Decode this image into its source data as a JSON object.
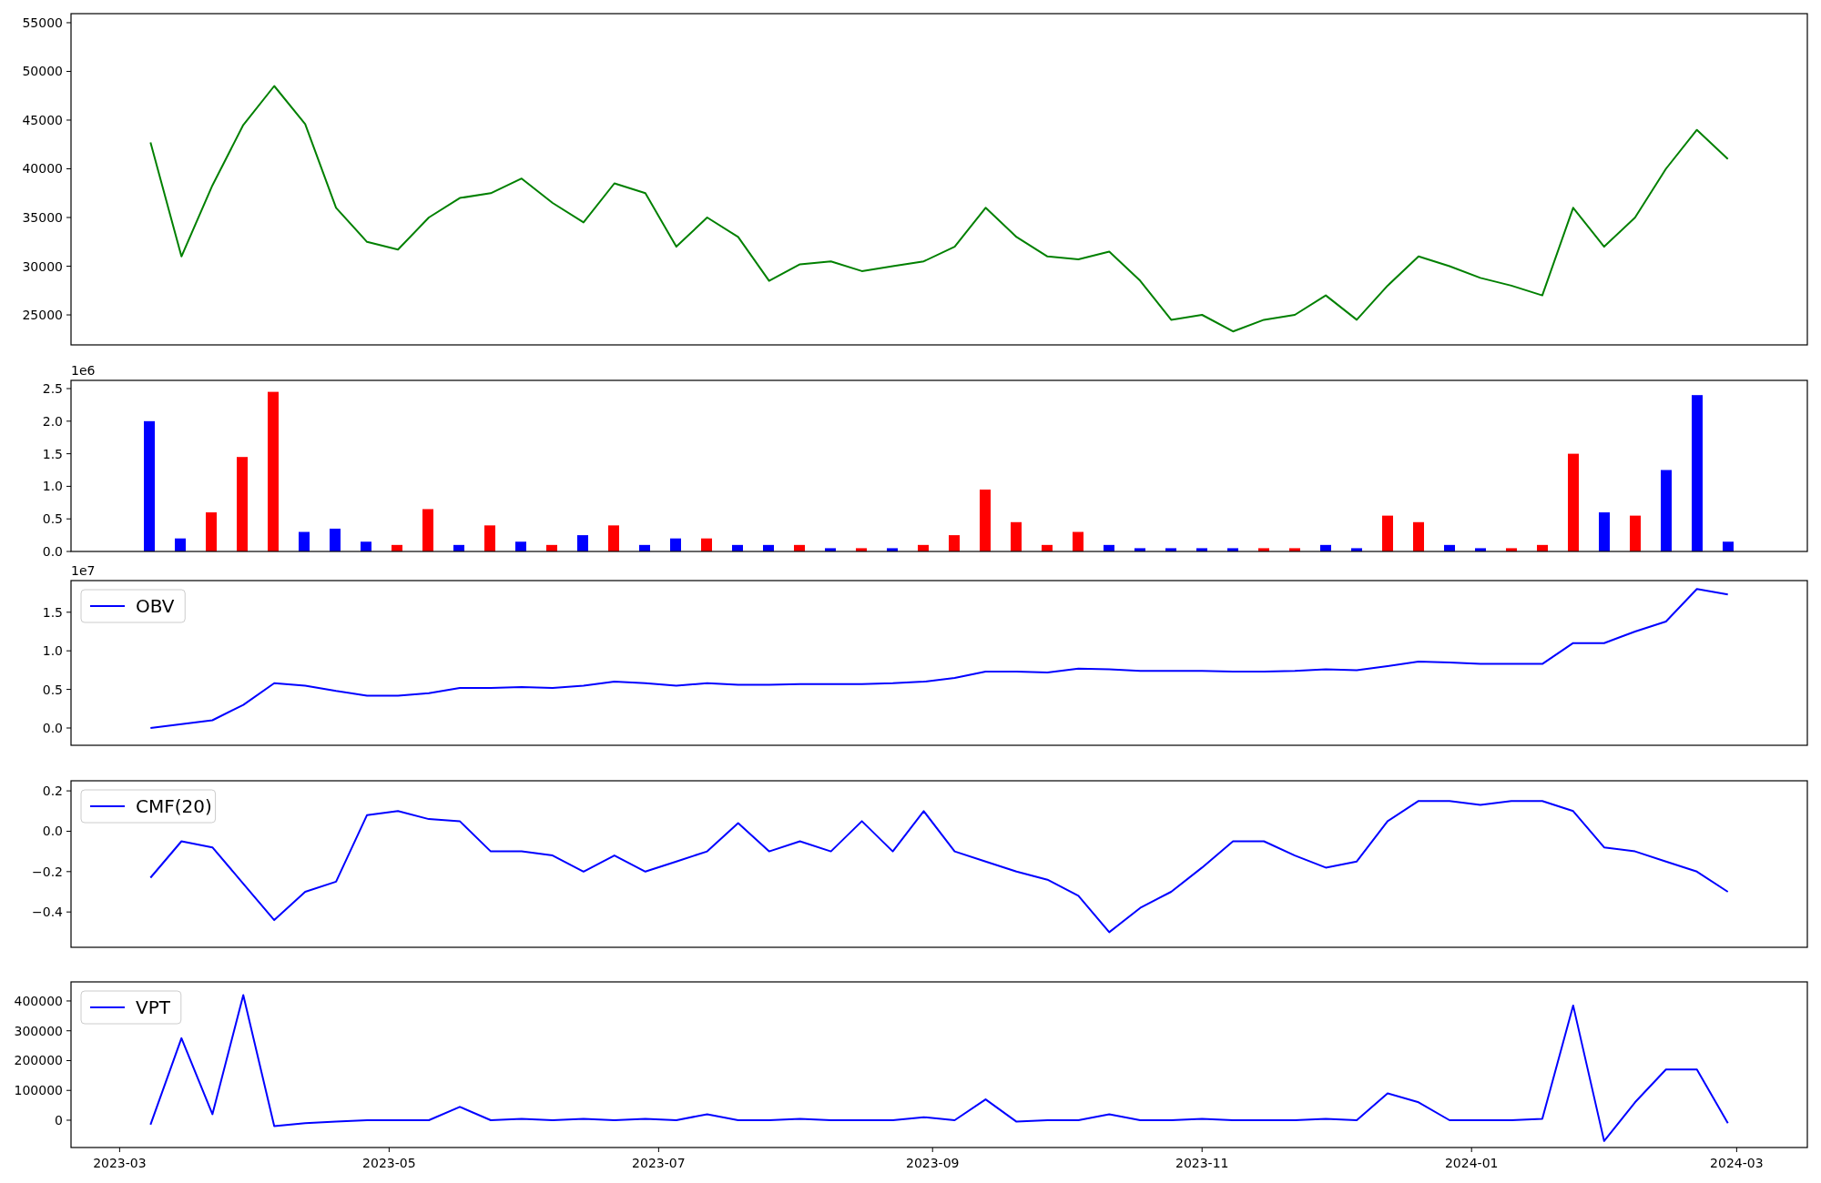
{
  "charts": [
    {
      "chart_data": {
        "type": "line",
        "x": [
          "2023-03-08",
          "2023-03-15",
          "2023-03-22",
          "2023-03-29",
          "2023-04-05",
          "2023-04-12",
          "2023-04-19",
          "2023-04-26",
          "2023-05-03",
          "2023-05-10",
          "2023-05-17",
          "2023-05-24",
          "2023-05-31",
          "2023-06-07",
          "2023-06-14",
          "2023-06-21",
          "2023-06-28",
          "2023-07-05",
          "2023-07-12",
          "2023-07-19",
          "2023-07-26",
          "2023-08-02",
          "2023-08-09",
          "2023-08-16",
          "2023-08-23",
          "2023-08-30",
          "2023-09-06",
          "2023-09-13",
          "2023-09-20",
          "2023-09-27",
          "2023-10-04",
          "2023-10-11",
          "2023-10-18",
          "2023-10-25",
          "2023-11-01",
          "2023-11-08",
          "2023-11-15",
          "2023-11-22",
          "2023-11-29",
          "2023-12-06",
          "2023-12-13",
          "2023-12-20",
          "2023-12-27",
          "2024-01-03",
          "2024-01-10",
          "2024-01-17",
          "2024-01-24",
          "2024-01-31",
          "2024-02-07",
          "2024-02-14",
          "2024-02-21",
          "2024-02-28"
        ],
        "series": [
          {
            "color": "#008000",
            "values": [
              42700,
              31000,
              38300,
              44500,
              48500,
              44600,
              36000,
              32500,
              31700,
              35000,
              37000,
              37500,
              39000,
              36500,
              34500,
              38500,
              37500,
              32000,
              35000,
              33000,
              28500,
              30200,
              30500,
              29500,
              30000,
              30500,
              32000,
              36000,
              33000,
              31000,
              30700,
              31500,
              28500,
              24500,
              25000,
              23300,
              24500,
              25000,
              27000,
              24500,
              28000,
              31000,
              30000,
              28800,
              28000,
              27000,
              36000,
              32000,
              35000,
              40000,
              44000,
              41000
            ]
          }
        ],
        "xlim": [
          "2023-02-18",
          "2024-03-17"
        ],
        "ylim": [
          21920,
          55930
        ],
        "yticks": [
          25000,
          30000,
          35000,
          40000,
          45000,
          50000,
          55000
        ]
      }
    },
    {
      "scale_label": "1e6",
      "chart_data": {
        "type": "bar",
        "categories": [
          null,
          null,
          null,
          null,
          null,
          null,
          null,
          null,
          null,
          null,
          null,
          null,
          null,
          null,
          null,
          null,
          null,
          null,
          null,
          null,
          null,
          null,
          null,
          null,
          null,
          null,
          null,
          null,
          null,
          null,
          null,
          null,
          null,
          null,
          null,
          null,
          null,
          null,
          null,
          null,
          null,
          null,
          null,
          null,
          null,
          null,
          null,
          null,
          null,
          null,
          null,
          null
        ],
        "series": [
          {
            "values": [
              2.0,
              0.2,
              0.6,
              1.45,
              2.45,
              0.3,
              0.35,
              0.15,
              0.1,
              0.65,
              0.1,
              0.4,
              0.15,
              0.1,
              0.25,
              0.4,
              0.1,
              0.2,
              0.2,
              0.1,
              0.1,
              0.1,
              0.05,
              0.05,
              0.05,
              0.1,
              0.25,
              0.95,
              0.45,
              0.1,
              0.3,
              0.1,
              0.05,
              0.05,
              0.05,
              0.05,
              0.05,
              0.05,
              0.1,
              0.05,
              0.55,
              0.45,
              0.1,
              0.05,
              0.05,
              0.1,
              1.5,
              0.6,
              0.55,
              1.25,
              2.4,
              0.15
            ],
            "colors": [
              "#0000ff",
              "#0000ff",
              "#ff0000",
              "#ff0000",
              "#ff0000",
              "#0000ff",
              "#0000ff",
              "#0000ff",
              "#ff0000",
              "#ff0000",
              "#0000ff",
              "#ff0000",
              "#0000ff",
              "#ff0000",
              "#0000ff",
              "#ff0000",
              "#0000ff",
              "#0000ff",
              "#ff0000",
              "#0000ff",
              "#0000ff",
              "#ff0000",
              "#0000ff",
              "#ff0000",
              "#0000ff",
              "#ff0000",
              "#ff0000",
              "#ff0000",
              "#ff0000",
              "#ff0000",
              "#ff0000",
              "#0000ff",
              "#0000ff",
              "#0000ff",
              "#0000ff",
              "#0000ff",
              "#ff0000",
              "#ff0000",
              "#0000ff",
              "#0000ff",
              "#ff0000",
              "#ff0000",
              "#0000ff",
              "#0000ff",
              "#ff0000",
              "#ff0000",
              "#ff0000",
              "#0000ff",
              "#ff0000",
              "#0000ff",
              "#0000ff",
              "#0000ff"
            ]
          }
        ],
        "ylim": [
          0,
          2.626
        ],
        "yticks": [
          {
            "value": 0,
            "label": "0.0"
          },
          {
            "value": 0.5,
            "label": "0.5"
          },
          {
            "value": 1.0,
            "label": "1.0"
          },
          {
            "value": 1.5,
            "label": "1.5"
          },
          {
            "value": 2.0,
            "label": "2.0"
          },
          {
            "value": 2.5,
            "label": "2.5"
          }
        ]
      }
    },
    {
      "scale_label": "1e7",
      "chart_data": {
        "type": "line",
        "x": [
          "2023-03-08",
          "2023-03-15",
          "2023-03-22",
          "2023-03-29",
          "2023-04-05",
          "2023-04-12",
          "2023-04-19",
          "2023-04-26",
          "2023-05-03",
          "2023-05-10",
          "2023-05-17",
          "2023-05-24",
          "2023-05-31",
          "2023-06-07",
          "2023-06-14",
          "2023-06-21",
          "2023-06-28",
          "2023-07-05",
          "2023-07-12",
          "2023-07-19",
          "2023-07-26",
          "2023-08-02",
          "2023-08-09",
          "2023-08-16",
          "2023-08-23",
          "2023-08-30",
          "2023-09-06",
          "2023-09-13",
          "2023-09-20",
          "2023-09-27",
          "2023-10-04",
          "2023-10-11",
          "2023-10-18",
          "2023-10-25",
          "2023-11-01",
          "2023-11-08",
          "2023-11-15",
          "2023-11-22",
          "2023-11-29",
          "2023-12-06",
          "2023-12-13",
          "2023-12-20",
          "2023-12-27",
          "2024-01-03",
          "2024-01-10",
          "2024-01-17",
          "2024-01-24",
          "2024-01-31",
          "2024-02-07",
          "2024-02-14",
          "2024-02-21",
          "2024-02-28"
        ],
        "series": [
          {
            "name": "OBV",
            "color": "#0000ff",
            "values": [
              0,
              0.05,
              0.1,
              0.3,
              0.58,
              0.55,
              0.48,
              0.42,
              0.42,
              0.45,
              0.52,
              0.52,
              0.53,
              0.52,
              0.55,
              0.6,
              0.58,
              0.55,
              0.58,
              0.56,
              0.56,
              0.57,
              0.57,
              0.57,
              0.58,
              0.6,
              0.65,
              0.73,
              0.73,
              0.72,
              0.77,
              0.76,
              0.74,
              0.74,
              0.74,
              0.73,
              0.73,
              0.74,
              0.76,
              0.75,
              0.8,
              0.86,
              0.85,
              0.83,
              0.83,
              0.83,
              1.1,
              1.1,
              1.25,
              1.38,
              1.8,
              1.73
            ]
          }
        ],
        "xlim": [
          "2023-02-18",
          "2024-03-17"
        ],
        "ylim": [
          -0.224,
          1.91
        ],
        "yticks": [
          {
            "value": 0,
            "label": "0.0"
          },
          {
            "value": 0.5,
            "label": "0.5"
          },
          {
            "value": 1.0,
            "label": "1.0"
          },
          {
            "value": 1.5,
            "label": "1.5"
          }
        ]
      }
    },
    {
      "chart_data": {
        "type": "line",
        "x": [
          "2023-03-08",
          "2023-03-15",
          "2023-03-22",
          "2023-03-29",
          "2023-04-05",
          "2023-04-12",
          "2023-04-19",
          "2023-04-26",
          "2023-05-03",
          "2023-05-10",
          "2023-05-17",
          "2023-05-24",
          "2023-05-31",
          "2023-06-07",
          "2023-06-14",
          "2023-06-21",
          "2023-06-28",
          "2023-07-05",
          "2023-07-12",
          "2023-07-19",
          "2023-07-26",
          "2023-08-02",
          "2023-08-09",
          "2023-08-16",
          "2023-08-23",
          "2023-08-30",
          "2023-09-06",
          "2023-09-13",
          "2023-09-20",
          "2023-09-27",
          "2023-10-04",
          "2023-10-11",
          "2023-10-18",
          "2023-10-25",
          "2023-11-01",
          "2023-11-08",
          "2023-11-15",
          "2023-11-22",
          "2023-11-29",
          "2023-12-06",
          "2023-12-13",
          "2023-12-20",
          "2023-12-27",
          "2024-01-03",
          "2024-01-10",
          "2024-01-17",
          "2024-01-24",
          "2024-01-31",
          "2024-02-07",
          "2024-02-14",
          "2024-02-21",
          "2024-02-28"
        ],
        "series": [
          {
            "name": "CMF(20)",
            "color": "#0000ff",
            "values": [
              -0.23,
              -0.05,
              -0.08,
              -0.26,
              -0.44,
              -0.3,
              -0.25,
              0.08,
              0.1,
              0.06,
              0.05,
              -0.1,
              -0.1,
              -0.12,
              -0.2,
              -0.12,
              -0.2,
              -0.15,
              -0.1,
              0.04,
              -0.1,
              -0.05,
              -0.1,
              0.05,
              -0.1,
              0.1,
              -0.1,
              -0.15,
              -0.2,
              -0.24,
              -0.32,
              -0.5,
              -0.38,
              -0.3,
              -0.18,
              -0.05,
              -0.05,
              -0.12,
              -0.18,
              -0.15,
              0.05,
              0.15,
              0.15,
              0.13,
              0.15,
              0.15,
              0.1,
              -0.08,
              -0.1,
              -0.15,
              -0.2,
              -0.3
            ]
          }
        ],
        "xlim": [
          "2023-02-18",
          "2024-03-17"
        ],
        "ylim": [
          -0.575,
          0.25
        ],
        "yticks": [
          {
            "value": -0.4,
            "label": "−0.4"
          },
          {
            "value": -0.2,
            "label": "−0.2"
          },
          {
            "value": 0,
            "label": "0.0"
          },
          {
            "value": 0.2,
            "label": "0.2"
          }
        ]
      }
    },
    {
      "chart_data": {
        "type": "line",
        "x": [
          "2023-03-08",
          "2023-03-15",
          "2023-03-22",
          "2023-03-29",
          "2023-04-05",
          "2023-04-12",
          "2023-04-19",
          "2023-04-26",
          "2023-05-03",
          "2023-05-10",
          "2023-05-17",
          "2023-05-24",
          "2023-05-31",
          "2023-06-07",
          "2023-06-14",
          "2023-06-21",
          "2023-06-28",
          "2023-07-05",
          "2023-07-12",
          "2023-07-19",
          "2023-07-26",
          "2023-08-02",
          "2023-08-09",
          "2023-08-16",
          "2023-08-23",
          "2023-08-30",
          "2023-09-06",
          "2023-09-13",
          "2023-09-20",
          "2023-09-27",
          "2023-10-04",
          "2023-10-11",
          "2023-10-18",
          "2023-10-25",
          "2023-11-01",
          "2023-11-08",
          "2023-11-15",
          "2023-11-22",
          "2023-11-29",
          "2023-12-06",
          "2023-12-13",
          "2023-12-20",
          "2023-12-27",
          "2024-01-03",
          "2024-01-10",
          "2024-01-17",
          "2024-01-24",
          "2024-01-31",
          "2024-02-07",
          "2024-02-14",
          "2024-02-21",
          "2024-02-28"
        ],
        "series": [
          {
            "name": "VPT",
            "color": "#0000ff",
            "values": [
              -15000,
              275000,
              20000,
              420000,
              -20000,
              -10000,
              -5000,
              0,
              0,
              0,
              45000,
              0,
              5000,
              0,
              5000,
              0,
              5000,
              0,
              20000,
              0,
              0,
              5000,
              0,
              0,
              0,
              10000,
              0,
              70000,
              -5000,
              0,
              0,
              20000,
              0,
              0,
              5000,
              0,
              0,
              0,
              5000,
              0,
              90000,
              60000,
              0,
              0,
              0,
              5000,
              385000,
              -70000,
              60000,
              170000,
              170000,
              -10000
            ]
          }
        ],
        "xlim": [
          "2023-02-18",
          "2024-03-17"
        ],
        "ylim": [
          -91600,
          464000
        ],
        "yticks": [
          {
            "value": 0,
            "label": "0"
          },
          {
            "value": 100000,
            "label": "100000"
          },
          {
            "value": 200000,
            "label": "200000"
          },
          {
            "value": 300000,
            "label": "300000"
          },
          {
            "value": 400000,
            "label": "400000"
          }
        ],
        "xticks": [
          {
            "value": "2023-03-01",
            "label": "2023-03"
          },
          {
            "value": "2023-05-01",
            "label": "2023-05"
          },
          {
            "value": "2023-07-01",
            "label": "2023-07"
          },
          {
            "value": "2023-09-01",
            "label": "2023-09"
          },
          {
            "value": "2023-11-01",
            "label": "2023-11"
          },
          {
            "value": "2024-01-01",
            "label": "2024-01"
          },
          {
            "value": "2024-03-01",
            "label": "2024-03"
          }
        ]
      }
    }
  ]
}
